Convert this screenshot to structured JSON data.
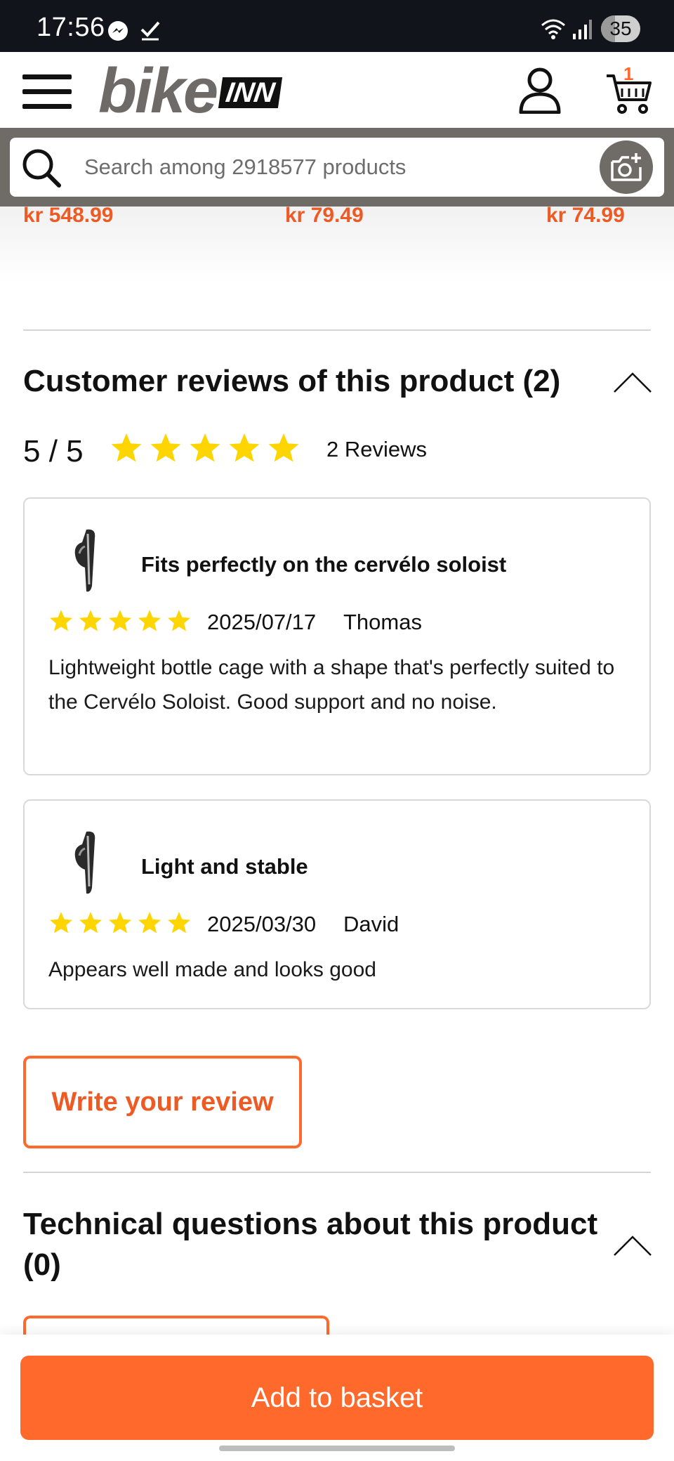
{
  "status_bar": {
    "time": "17:56",
    "battery": "35"
  },
  "header": {
    "logo_bike": "bike",
    "logo_inn": "INN",
    "cart_count": "1"
  },
  "search": {
    "placeholder": "Search among 2918577 products"
  },
  "prices": [
    "kr 548.99",
    "kr 79.49",
    "kr 74.99"
  ],
  "reviews_section": {
    "title": "Customer reviews of this product (2)",
    "score": "5 / 5",
    "stars": 5,
    "count_label": "2 Reviews",
    "reviews": [
      {
        "title": "Fits perfectly on the cervélo soloist",
        "rating": 5,
        "date": "2025/07/17",
        "author": "Thomas",
        "text": "Lightweight bottle cage with a shape that's perfectly suited to the Cervélo Soloist. Good support and no noise."
      },
      {
        "title": "Light and stable",
        "rating": 5,
        "date": "2025/03/30",
        "author": "David",
        "text": "Appears well made and looks good"
      }
    ],
    "write_label": "Write your review"
  },
  "questions_section": {
    "title": "Technical questions about this product (0)"
  },
  "bottom": {
    "add_label": "Add to basket"
  },
  "colors": {
    "accent": "#ff6a2c",
    "price": "#ee5a24",
    "star": "#ffd500",
    "brand_grey": "#6f6b67"
  }
}
